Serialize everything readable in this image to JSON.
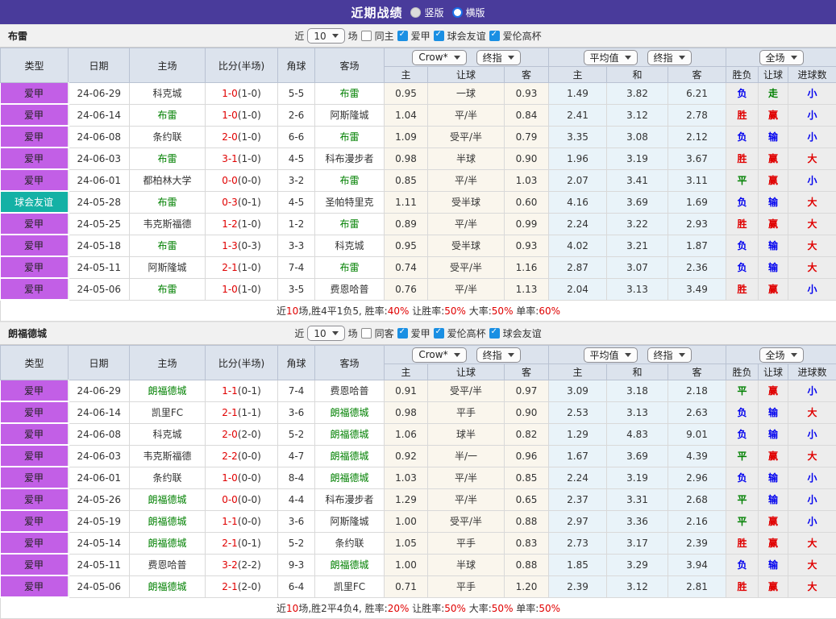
{
  "titlebar": {
    "title": "近期战绩",
    "radio_vertical": "竖版",
    "radio_horizontal": "横版",
    "bar_color": "#493b9b"
  },
  "filter_labels": {
    "near": "近",
    "games": "场"
  },
  "selects": {
    "odds_source": "Crow*",
    "odds_stage": "终指",
    "avg_source": "平均值",
    "avg_stage": "终指",
    "scope": "全场"
  },
  "columns": {
    "type": "类型",
    "date": "日期",
    "home": "主场",
    "score": "比分(半场)",
    "corner": "角球",
    "away": "客场",
    "odds_home": "主",
    "odds_handicap": "让球",
    "odds_away": "客",
    "avg_home": "主",
    "avg_draw": "和",
    "avg_away": "客",
    "result": "胜负",
    "handicap_result": "让球",
    "goals": "进球数"
  },
  "status_colors": {
    "win_red": "#e00000",
    "draw_green": "#008000",
    "lose_blue": "#0000ee",
    "team_green": "#008000",
    "league_purple": "#c25fe6",
    "friendly_teal": "#14b1a5"
  },
  "sections": [
    {
      "team": "布雷",
      "filter": {
        "count": "10",
        "same_label": "同主",
        "same_checked": false,
        "leagues": [
          {
            "label": "爱甲",
            "checked": true
          },
          {
            "label": "球会友谊",
            "checked": true
          },
          {
            "label": "爱伦高杯",
            "checked": true
          }
        ]
      },
      "rows": [
        {
          "league": "爱甲",
          "league_style": "purple",
          "date": "24-06-29",
          "home": "科克城",
          "home_hl": false,
          "score": "1-0",
          "half": "(1-0)",
          "corner": "5-5",
          "away": "布雷",
          "away_hl": true,
          "odds": [
            "0.95",
            "一球",
            "0.93"
          ],
          "avg": [
            "1.49",
            "3.82",
            "6.21"
          ],
          "outcome": [
            [
              "负",
              "b"
            ],
            [
              "走",
              "g"
            ],
            [
              "小",
              "b"
            ]
          ]
        },
        {
          "league": "爱甲",
          "league_style": "purple",
          "date": "24-06-14",
          "home": "布雷",
          "home_hl": true,
          "score": "1-0",
          "half": "(1-0)",
          "corner": "2-6",
          "away": "阿斯隆城",
          "away_hl": false,
          "odds": [
            "1.04",
            "平/半",
            "0.84"
          ],
          "avg": [
            "2.41",
            "3.12",
            "2.78"
          ],
          "outcome": [
            [
              "胜",
              "r"
            ],
            [
              "赢",
              "r"
            ],
            [
              "小",
              "b"
            ]
          ]
        },
        {
          "league": "爱甲",
          "league_style": "purple",
          "date": "24-06-08",
          "home": "条约联",
          "home_hl": false,
          "score": "2-0",
          "half": "(1-0)",
          "corner": "6-6",
          "away": "布雷",
          "away_hl": true,
          "odds": [
            "1.09",
            "受平/半",
            "0.79"
          ],
          "avg": [
            "3.35",
            "3.08",
            "2.12"
          ],
          "outcome": [
            [
              "负",
              "b"
            ],
            [
              "输",
              "b"
            ],
            [
              "小",
              "b"
            ]
          ]
        },
        {
          "league": "爱甲",
          "league_style": "purple",
          "date": "24-06-03",
          "home": "布雷",
          "home_hl": true,
          "score": "3-1",
          "half": "(1-0)",
          "corner": "4-5",
          "away": "科布漫步者",
          "away_hl": false,
          "odds": [
            "0.98",
            "半球",
            "0.90"
          ],
          "avg": [
            "1.96",
            "3.19",
            "3.67"
          ],
          "outcome": [
            [
              "胜",
              "r"
            ],
            [
              "赢",
              "r"
            ],
            [
              "大",
              "r"
            ]
          ]
        },
        {
          "league": "爱甲",
          "league_style": "purple",
          "date": "24-06-01",
          "home": "都柏林大学",
          "home_hl": false,
          "score": "0-0",
          "half": "(0-0)",
          "corner": "3-2",
          "away": "布雷",
          "away_hl": true,
          "odds": [
            "0.85",
            "平/半",
            "1.03"
          ],
          "avg": [
            "2.07",
            "3.41",
            "3.11"
          ],
          "outcome": [
            [
              "平",
              "g"
            ],
            [
              "赢",
              "r"
            ],
            [
              "小",
              "b"
            ]
          ]
        },
        {
          "league": "球会友谊",
          "league_style": "teal",
          "date": "24-05-28",
          "home": "布雷",
          "home_hl": true,
          "score": "0-3",
          "half": "(0-1)",
          "corner": "4-5",
          "away": "圣帕特里克",
          "away_hl": false,
          "odds": [
            "1.11",
            "受半球",
            "0.60"
          ],
          "avg": [
            "4.16",
            "3.69",
            "1.69"
          ],
          "outcome": [
            [
              "负",
              "b"
            ],
            [
              "输",
              "b"
            ],
            [
              "大",
              "r"
            ]
          ]
        },
        {
          "league": "爱甲",
          "league_style": "purple",
          "date": "24-05-25",
          "home": "韦克斯福德",
          "home_hl": false,
          "score": "1-2",
          "half": "(1-0)",
          "corner": "1-2",
          "away": "布雷",
          "away_hl": true,
          "odds": [
            "0.89",
            "平/半",
            "0.99"
          ],
          "avg": [
            "2.24",
            "3.22",
            "2.93"
          ],
          "outcome": [
            [
              "胜",
              "r"
            ],
            [
              "赢",
              "r"
            ],
            [
              "大",
              "r"
            ]
          ]
        },
        {
          "league": "爱甲",
          "league_style": "purple",
          "date": "24-05-18",
          "home": "布雷",
          "home_hl": true,
          "score": "1-3",
          "half": "(0-3)",
          "corner": "3-3",
          "away": "科克城",
          "away_hl": false,
          "odds": [
            "0.95",
            "受半球",
            "0.93"
          ],
          "avg": [
            "4.02",
            "3.21",
            "1.87"
          ],
          "outcome": [
            [
              "负",
              "b"
            ],
            [
              "输",
              "b"
            ],
            [
              "大",
              "r"
            ]
          ]
        },
        {
          "league": "爱甲",
          "league_style": "purple",
          "date": "24-05-11",
          "home": "阿斯隆城",
          "home_hl": false,
          "score": "2-1",
          "half": "(1-0)",
          "corner": "7-4",
          "away": "布雷",
          "away_hl": true,
          "odds": [
            "0.74",
            "受平/半",
            "1.16"
          ],
          "avg": [
            "2.87",
            "3.07",
            "2.36"
          ],
          "outcome": [
            [
              "负",
              "b"
            ],
            [
              "输",
              "b"
            ],
            [
              "大",
              "r"
            ]
          ]
        },
        {
          "league": "爱甲",
          "league_style": "purple",
          "date": "24-05-06",
          "home": "布雷",
          "home_hl": true,
          "score": "1-0",
          "half": "(1-0)",
          "corner": "3-5",
          "away": "费恩哈普",
          "away_hl": false,
          "odds": [
            "0.76",
            "平/半",
            "1.13"
          ],
          "avg": [
            "2.04",
            "3.13",
            "3.49"
          ],
          "outcome": [
            [
              "胜",
              "r"
            ],
            [
              "赢",
              "r"
            ],
            [
              "小",
              "b"
            ]
          ]
        }
      ],
      "summary": [
        {
          "t": "近",
          "red": false
        },
        {
          "t": "10",
          "red": true
        },
        {
          "t": "场,胜4平1负5, 胜率:",
          "red": false
        },
        {
          "t": "40%",
          "red": true
        },
        {
          "t": " 让胜率:",
          "red": false
        },
        {
          "t": "50%",
          "red": true
        },
        {
          "t": " 大率:",
          "red": false
        },
        {
          "t": "50%",
          "red": true
        },
        {
          "t": " 单率:",
          "red": false
        },
        {
          "t": "60%",
          "red": true
        }
      ]
    },
    {
      "team": "朗福德城",
      "filter": {
        "count": "10",
        "same_label": "同客",
        "same_checked": false,
        "leagues": [
          {
            "label": "爱甲",
            "checked": true
          },
          {
            "label": "爱伦高杯",
            "checked": true
          },
          {
            "label": "球会友谊",
            "checked": true
          }
        ]
      },
      "rows": [
        {
          "league": "爱甲",
          "league_style": "purple",
          "date": "24-06-29",
          "home": "朗福德城",
          "home_hl": true,
          "score": "1-1",
          "half": "(0-1)",
          "corner": "7-4",
          "away": "费恩哈普",
          "away_hl": false,
          "odds": [
            "0.91",
            "受平/半",
            "0.97"
          ],
          "avg": [
            "3.09",
            "3.18",
            "2.18"
          ],
          "outcome": [
            [
              "平",
              "g"
            ],
            [
              "赢",
              "r"
            ],
            [
              "小",
              "b"
            ]
          ]
        },
        {
          "league": "爱甲",
          "league_style": "purple",
          "date": "24-06-14",
          "home": "凯里FC",
          "home_hl": false,
          "score": "2-1",
          "half": "(1-1)",
          "corner": "3-6",
          "away": "朗福德城",
          "away_hl": true,
          "odds": [
            "0.98",
            "平手",
            "0.90"
          ],
          "avg": [
            "2.53",
            "3.13",
            "2.63"
          ],
          "outcome": [
            [
              "负",
              "b"
            ],
            [
              "输",
              "b"
            ],
            [
              "大",
              "r"
            ]
          ]
        },
        {
          "league": "爱甲",
          "league_style": "purple",
          "date": "24-06-08",
          "home": "科克城",
          "home_hl": false,
          "score": "2-0",
          "half": "(2-0)",
          "corner": "5-2",
          "away": "朗福德城",
          "away_hl": true,
          "odds": [
            "1.06",
            "球半",
            "0.82"
          ],
          "avg": [
            "1.29",
            "4.83",
            "9.01"
          ],
          "outcome": [
            [
              "负",
              "b"
            ],
            [
              "输",
              "b"
            ],
            [
              "小",
              "b"
            ]
          ]
        },
        {
          "league": "爱甲",
          "league_style": "purple",
          "date": "24-06-03",
          "home": "韦克斯福德",
          "home_hl": false,
          "score": "2-2",
          "half": "(0-0)",
          "corner": "4-7",
          "away": "朗福德城",
          "away_hl": true,
          "odds": [
            "0.92",
            "半/一",
            "0.96"
          ],
          "avg": [
            "1.67",
            "3.69",
            "4.39"
          ],
          "outcome": [
            [
              "平",
              "g"
            ],
            [
              "赢",
              "r"
            ],
            [
              "大",
              "r"
            ]
          ]
        },
        {
          "league": "爱甲",
          "league_style": "purple",
          "date": "24-06-01",
          "home": "条约联",
          "home_hl": false,
          "score": "1-0",
          "half": "(0-0)",
          "corner": "8-4",
          "away": "朗福德城",
          "away_hl": true,
          "odds": [
            "1.03",
            "平/半",
            "0.85"
          ],
          "avg": [
            "2.24",
            "3.19",
            "2.96"
          ],
          "outcome": [
            [
              "负",
              "b"
            ],
            [
              "输",
              "b"
            ],
            [
              "小",
              "b"
            ]
          ]
        },
        {
          "league": "爱甲",
          "league_style": "purple",
          "date": "24-05-26",
          "home": "朗福德城",
          "home_hl": true,
          "score": "0-0",
          "half": "(0-0)",
          "corner": "4-4",
          "away": "科布漫步者",
          "away_hl": false,
          "odds": [
            "1.29",
            "平/半",
            "0.65"
          ],
          "avg": [
            "2.37",
            "3.31",
            "2.68"
          ],
          "outcome": [
            [
              "平",
              "g"
            ],
            [
              "输",
              "b"
            ],
            [
              "小",
              "b"
            ]
          ]
        },
        {
          "league": "爱甲",
          "league_style": "purple",
          "date": "24-05-19",
          "home": "朗福德城",
          "home_hl": true,
          "score": "1-1",
          "half": "(0-0)",
          "corner": "3-6",
          "away": "阿斯隆城",
          "away_hl": false,
          "odds": [
            "1.00",
            "受平/半",
            "0.88"
          ],
          "avg": [
            "2.97",
            "3.36",
            "2.16"
          ],
          "outcome": [
            [
              "平",
              "g"
            ],
            [
              "赢",
              "r"
            ],
            [
              "小",
              "b"
            ]
          ]
        },
        {
          "league": "爱甲",
          "league_style": "purple",
          "date": "24-05-14",
          "home": "朗福德城",
          "home_hl": true,
          "score": "2-1",
          "half": "(0-1)",
          "corner": "5-2",
          "away": "条约联",
          "away_hl": false,
          "odds": [
            "1.05",
            "平手",
            "0.83"
          ],
          "avg": [
            "2.73",
            "3.17",
            "2.39"
          ],
          "outcome": [
            [
              "胜",
              "r"
            ],
            [
              "赢",
              "r"
            ],
            [
              "大",
              "r"
            ]
          ]
        },
        {
          "league": "爱甲",
          "league_style": "purple",
          "date": "24-05-11",
          "home": "费恩哈普",
          "home_hl": false,
          "score": "3-2",
          "half": "(2-2)",
          "corner": "9-3",
          "away": "朗福德城",
          "away_hl": true,
          "odds": [
            "1.00",
            "半球",
            "0.88"
          ],
          "avg": [
            "1.85",
            "3.29",
            "3.94"
          ],
          "outcome": [
            [
              "负",
              "b"
            ],
            [
              "输",
              "b"
            ],
            [
              "大",
              "r"
            ]
          ]
        },
        {
          "league": "爱甲",
          "league_style": "purple",
          "date": "24-05-06",
          "home": "朗福德城",
          "home_hl": true,
          "score": "2-1",
          "half": "(2-0)",
          "corner": "6-4",
          "away": "凯里FC",
          "away_hl": false,
          "odds": [
            "0.71",
            "平手",
            "1.20"
          ],
          "avg": [
            "2.39",
            "3.12",
            "2.81"
          ],
          "outcome": [
            [
              "胜",
              "r"
            ],
            [
              "赢",
              "r"
            ],
            [
              "大",
              "r"
            ]
          ]
        }
      ],
      "summary": [
        {
          "t": "近",
          "red": false
        },
        {
          "t": "10",
          "red": true
        },
        {
          "t": "场,胜2平4负4, 胜率:",
          "red": false
        },
        {
          "t": "20%",
          "red": true
        },
        {
          "t": " 让胜率:",
          "red": false
        },
        {
          "t": "50%",
          "red": true
        },
        {
          "t": " 大率:",
          "red": false
        },
        {
          "t": "50%",
          "red": true
        },
        {
          "t": " 单率:",
          "red": false
        },
        {
          "t": "50%",
          "red": true
        }
      ]
    }
  ]
}
